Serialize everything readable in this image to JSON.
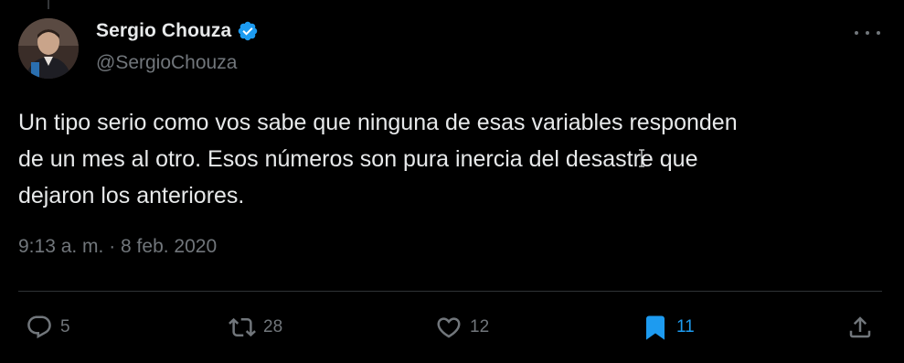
{
  "author": {
    "display_name": "Sergio Chouza",
    "handle": "@SergioChouza",
    "verified_icon": "verified-badge-icon",
    "verified_color": "#1d9bf0"
  },
  "tweet": {
    "text": "Un tipo serio como vos sabe que ninguna de esas variables responden\nde un mes al otro. Esos números son pura inercia del desastre que\ndejaron los anteriores.",
    "timestamp": "9:13 a. m. · 8 feb. 2020"
  },
  "actions": {
    "reply": {
      "icon": "reply-icon",
      "count": "5"
    },
    "retweet": {
      "icon": "retweet-icon",
      "count": "28"
    },
    "like": {
      "icon": "heart-icon",
      "count": "12"
    },
    "bookmark": {
      "icon": "bookmark-icon",
      "count": "11",
      "active": true
    },
    "share": {
      "icon": "share-icon"
    }
  },
  "colors": {
    "background": "#000000",
    "text_primary": "#e7e9ea",
    "text_secondary": "#71767b",
    "accent": "#1d9bf0",
    "divider": "#2f3336"
  }
}
